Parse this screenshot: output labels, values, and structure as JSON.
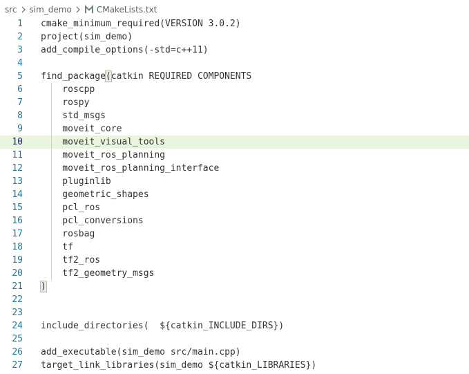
{
  "breadcrumb": {
    "items": [
      "src",
      "sim_demo"
    ],
    "file": "CMakeLists.txt",
    "file_icon": "M"
  },
  "editor": {
    "current_line": 10,
    "lines": [
      {
        "n": "1",
        "indent": false,
        "pre": "",
        "br": "",
        "post": "cmake_minimum_required(VERSION 3.0.2)"
      },
      {
        "n": "2",
        "indent": false,
        "pre": "",
        "br": "",
        "post": "project(sim_demo)"
      },
      {
        "n": "3",
        "indent": false,
        "pre": "",
        "br": "",
        "post": "add_compile_options(-std=c++11)"
      },
      {
        "n": "4",
        "indent": false,
        "pre": "",
        "br": "",
        "post": ""
      },
      {
        "n": "5",
        "indent": false,
        "pre": "find_package",
        "br": "(",
        "post": "catkin REQUIRED COMPONENTS"
      },
      {
        "n": "6",
        "indent": true,
        "pre": "",
        "br": "",
        "post": "    roscpp"
      },
      {
        "n": "7",
        "indent": true,
        "pre": "",
        "br": "",
        "post": "    rospy"
      },
      {
        "n": "8",
        "indent": true,
        "pre": "",
        "br": "",
        "post": "    std_msgs"
      },
      {
        "n": "9",
        "indent": true,
        "pre": "",
        "br": "",
        "post": "    moveit_core"
      },
      {
        "n": "10",
        "indent": true,
        "pre": "",
        "br": "",
        "post": "    moveit_visual_tools"
      },
      {
        "n": "11",
        "indent": true,
        "pre": "",
        "br": "",
        "post": "    moveit_ros_planning"
      },
      {
        "n": "12",
        "indent": true,
        "pre": "",
        "br": "",
        "post": "    moveit_ros_planning_interface"
      },
      {
        "n": "13",
        "indent": true,
        "pre": "",
        "br": "",
        "post": "    pluginlib"
      },
      {
        "n": "14",
        "indent": true,
        "pre": "",
        "br": "",
        "post": "    geometric_shapes"
      },
      {
        "n": "15",
        "indent": true,
        "pre": "",
        "br": "",
        "post": "    pcl_ros"
      },
      {
        "n": "16",
        "indent": true,
        "pre": "",
        "br": "",
        "post": "    pcl_conversions"
      },
      {
        "n": "17",
        "indent": true,
        "pre": "",
        "br": "",
        "post": "    rosbag"
      },
      {
        "n": "18",
        "indent": true,
        "pre": "",
        "br": "",
        "post": "    tf"
      },
      {
        "n": "19",
        "indent": true,
        "pre": "",
        "br": "",
        "post": "    tf2_ros"
      },
      {
        "n": "20",
        "indent": true,
        "pre": "",
        "br": "",
        "post": "    tf2_geometry_msgs"
      },
      {
        "n": "21",
        "indent": false,
        "pre": "",
        "br": ")",
        "post": ""
      },
      {
        "n": "22",
        "indent": false,
        "pre": "",
        "br": "",
        "post": ""
      },
      {
        "n": "23",
        "indent": false,
        "pre": "",
        "br": "",
        "post": ""
      },
      {
        "n": "24",
        "indent": false,
        "pre": "",
        "br": "",
        "post": "include_directories(  ${catkin_INCLUDE_DIRS})"
      },
      {
        "n": "25",
        "indent": false,
        "pre": "",
        "br": "",
        "post": ""
      },
      {
        "n": "26",
        "indent": false,
        "pre": "",
        "br": "",
        "post": "add_executable(sim_demo src/main.cpp)"
      },
      {
        "n": "27",
        "indent": false,
        "pre": "",
        "br": "",
        "post": "target_link_libraries(sim_demo ${catkin_LIBRARIES})"
      }
    ]
  },
  "colors": {
    "line_number": "#237893",
    "current_line_bg": "#e9f5de",
    "text": "#333333",
    "file_icon": "#6d8086"
  },
  "icons": {
    "separator": "chevron-right-icon",
    "file": "cmake-file-icon"
  }
}
